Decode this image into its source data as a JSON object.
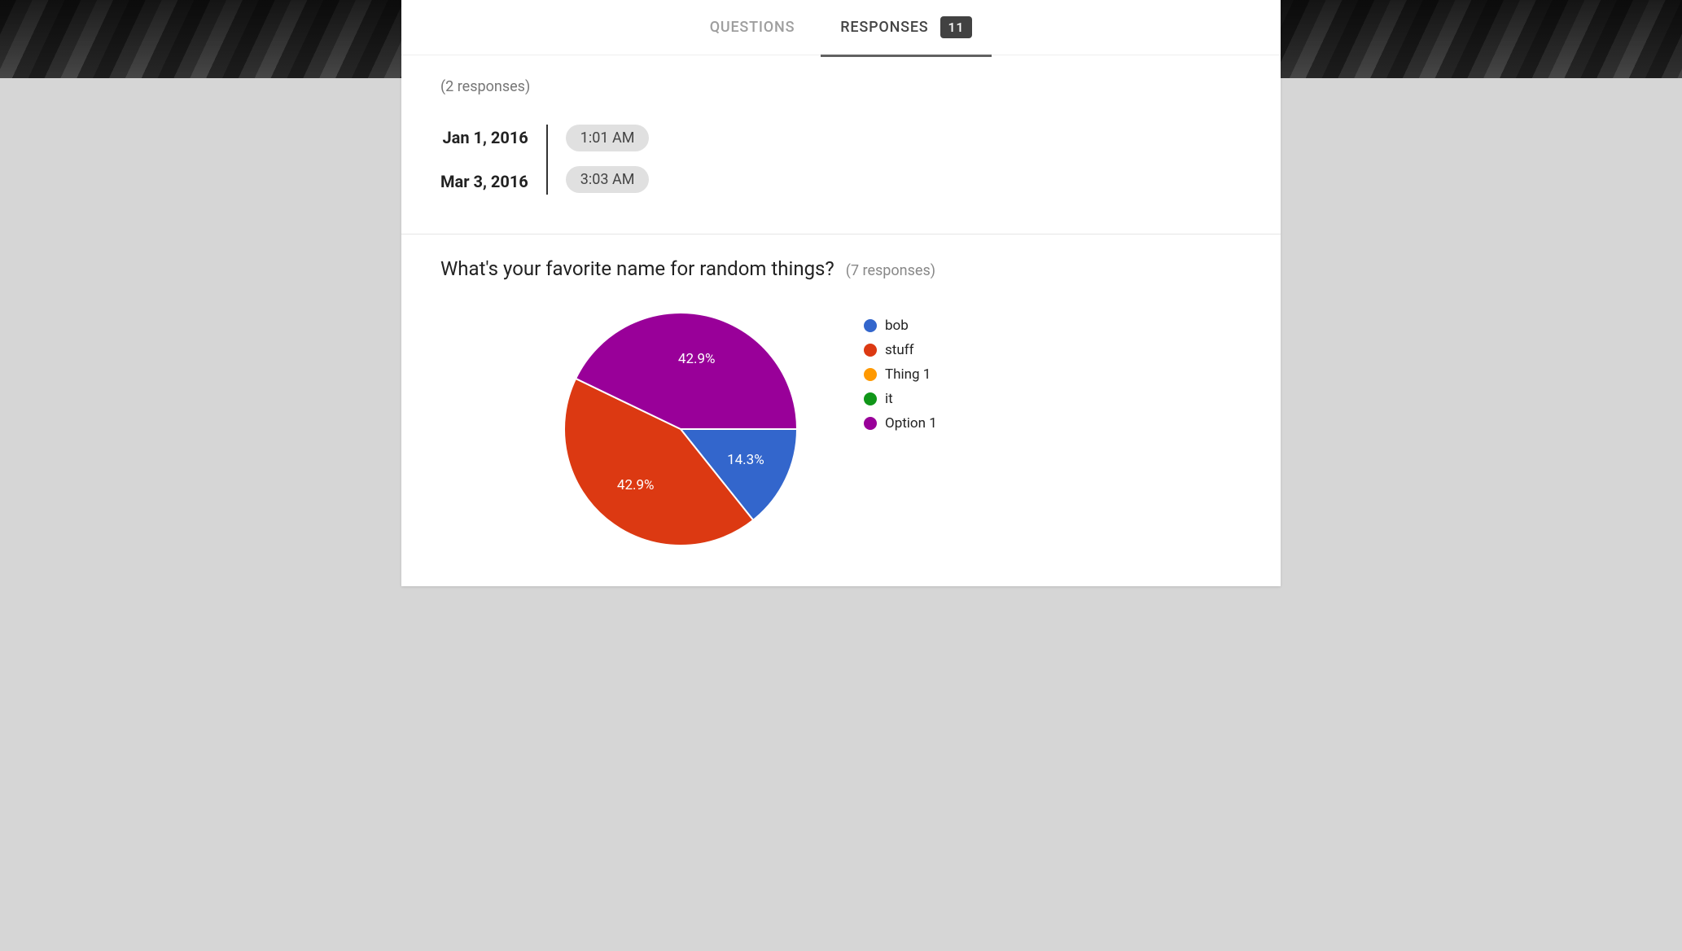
{
  "tabs": {
    "questions": "QUESTIONS",
    "responses": "RESPONSES",
    "badge": "11"
  },
  "top_section": {
    "count_label": "(2 responses)",
    "rows": [
      {
        "date": "Jan 1, 2016",
        "time": "1:01 AM"
      },
      {
        "date": "Mar 3, 2016",
        "time": "3:03 AM"
      }
    ]
  },
  "chart_section": {
    "title": "What's your favorite name for random things?",
    "count_label": "(7 responses)"
  },
  "chart_data": {
    "type": "pie",
    "title": "What's your favorite name for random things?",
    "series": [
      {
        "name": "bob",
        "value": 1,
        "percent": "14.3%",
        "color": "#3366cc"
      },
      {
        "name": "stuff",
        "value": 3,
        "percent": "42.9%",
        "color": "#dc3912"
      },
      {
        "name": "Thing 1",
        "value": 0,
        "percent": "0%",
        "color": "#ff9900"
      },
      {
        "name": "it",
        "value": 0,
        "percent": "0%",
        "color": "#109618"
      },
      {
        "name": "Option 1",
        "value": 3,
        "percent": "42.9%",
        "color": "#990099"
      }
    ],
    "total_responses": 7
  }
}
